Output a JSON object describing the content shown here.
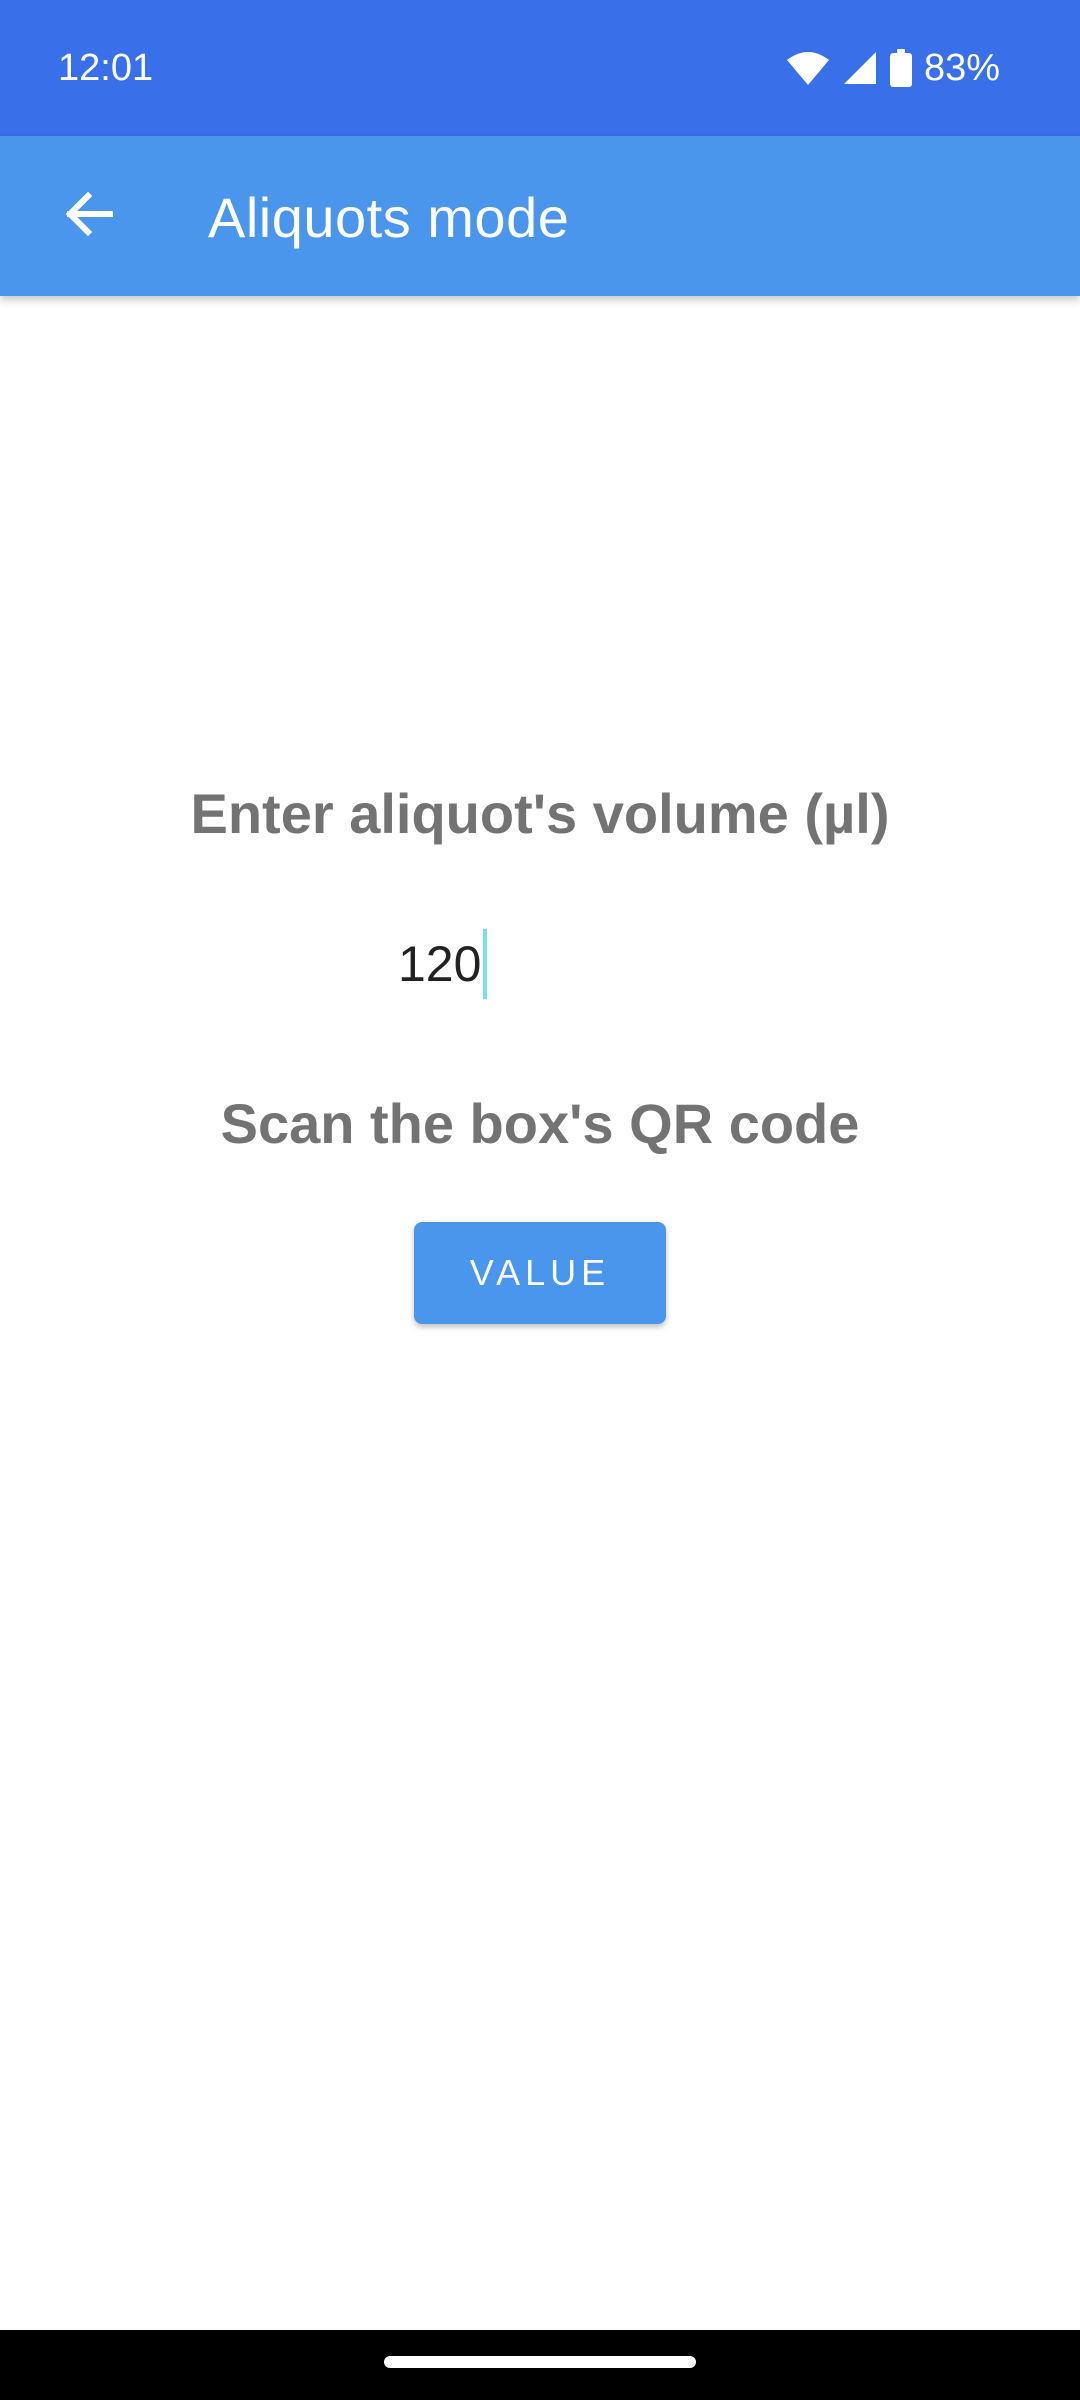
{
  "status_bar": {
    "time": "12:01",
    "battery": "83%",
    "icons": [
      "wifi-icon",
      "signal-icon",
      "battery-icon"
    ]
  },
  "app_bar": {
    "title": "Aliquots mode",
    "back_icon": "arrow-back-icon"
  },
  "main": {
    "volume_prompt": "Enter aliquot's volume (µl)",
    "volume_value": "120",
    "scan_prompt": "Scan the box's QR code",
    "value_button": "VALUE"
  },
  "colors": {
    "status_bar": "#3a6fea",
    "app_bar": "#4a96ed",
    "button": "#4a96ed",
    "prompt_text": "#737373",
    "cursor": "#7be0e8"
  }
}
